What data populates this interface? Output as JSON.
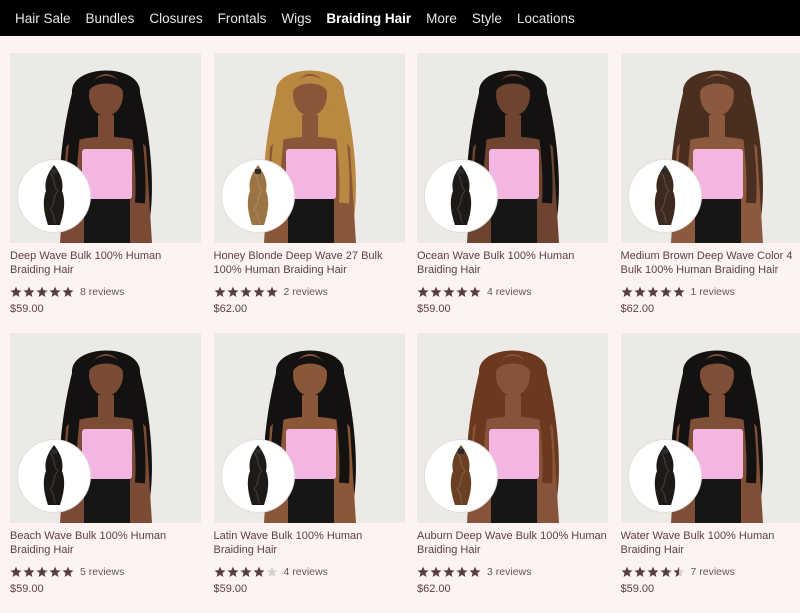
{
  "nav": {
    "items": [
      "Hair Sale",
      "Bundles",
      "Closures",
      "Frontals",
      "Wigs",
      "Braiding Hair",
      "More",
      "Style",
      "Locations"
    ],
    "active_index": 5
  },
  "colors": {
    "star_filled": "#5a3e46",
    "star_empty": "#d9d0d0",
    "top_pink": "#f2b6e0"
  },
  "products": [
    {
      "title": "Deep Wave Bulk 100% Human Braiding Hair",
      "rating": 5,
      "reviews": "8 reviews",
      "price": "$59.00",
      "hair_color": "#141111",
      "bundle_color": "#1e1a16"
    },
    {
      "title": "Honey Blonde Deep Wave 27 Bulk 100% Human Braiding Hair",
      "rating": 5,
      "reviews": "2 reviews",
      "price": "$62.00",
      "hair_color": "#b98942",
      "bundle_color": "#9a7443"
    },
    {
      "title": "Ocean Wave Bulk 100% Human Braiding Hair",
      "rating": 5,
      "reviews": "4 reviews",
      "price": "$59.00",
      "hair_color": "#141111",
      "bundle_color": "#1c1917"
    },
    {
      "title": "Medium Brown Deep Wave Color 4 Bulk 100% Human Braiding Hair",
      "rating": 5,
      "reviews": "1 reviews",
      "price": "$62.00",
      "hair_color": "#4a2e1f",
      "bundle_color": "#3d2a1f"
    },
    {
      "title": "Beach Wave Bulk 100% Human Braiding Hair",
      "rating": 5,
      "reviews": "5 reviews",
      "price": "$59.00",
      "hair_color": "#141111",
      "bundle_color": "#1a1715"
    },
    {
      "title": "Latin Wave Bulk 100% Human Braiding Hair",
      "rating": 4,
      "reviews": "4 reviews",
      "price": "$59.00",
      "hair_color": "#141111",
      "bundle_color": "#1d1a18"
    },
    {
      "title": "Auburn Deep Wave Bulk 100% Human Braiding Hair",
      "rating": 5,
      "reviews": "3 reviews",
      "price": "$62.00",
      "hair_color": "#6b3a1e",
      "bundle_color": "#6a3f22"
    },
    {
      "title": "Water Wave Bulk 100% Human Braiding Hair",
      "rating": 4.5,
      "reviews": "7 reviews",
      "price": "$59.00",
      "hair_color": "#141111",
      "bundle_color": "#1c1917"
    }
  ]
}
